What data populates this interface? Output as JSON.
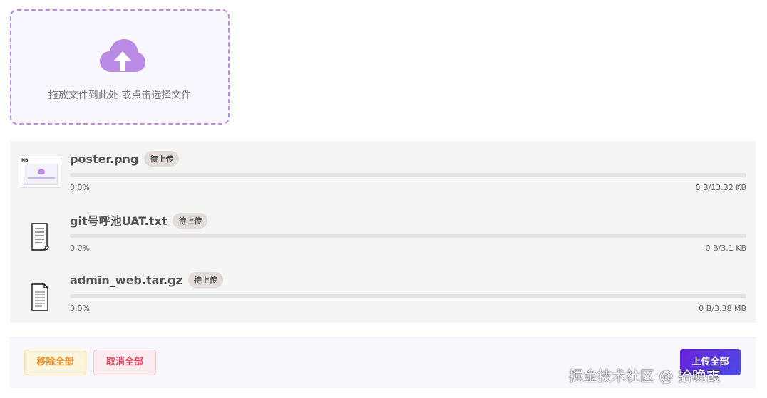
{
  "dropzone": {
    "hint": "拖放文件到此处 或点击选择文件",
    "accent": "#b98be6"
  },
  "files": [
    {
      "name": "poster.png",
      "status": "待上传",
      "percent": "0.0%",
      "size": "0 B/13.32 KB",
      "progress": 0,
      "icon": "image-thumbnail",
      "thumb_title": "NB"
    },
    {
      "name": "git号呼池UAT.txt",
      "status": "待上传",
      "percent": "0.0%",
      "size": "0 B/3.1 KB",
      "progress": 0,
      "icon": "text-document-icon"
    },
    {
      "name": "admin_web.tar.gz",
      "status": "待上传",
      "percent": "0.0%",
      "size": "0 B/3.38 MB",
      "progress": 0,
      "icon": "document-icon"
    }
  ],
  "footer": {
    "remove_all": "移除全部",
    "cancel_all": "取消全部",
    "upload_all": "上传全部"
  },
  "watermark": "掘金技术社区 @ 拾晚霞",
  "colors": {
    "remove": "#e8902a",
    "cancel": "#e0455f",
    "upload_gradient_start": "#6a22d8",
    "upload_gradient_end": "#4b4be6"
  }
}
